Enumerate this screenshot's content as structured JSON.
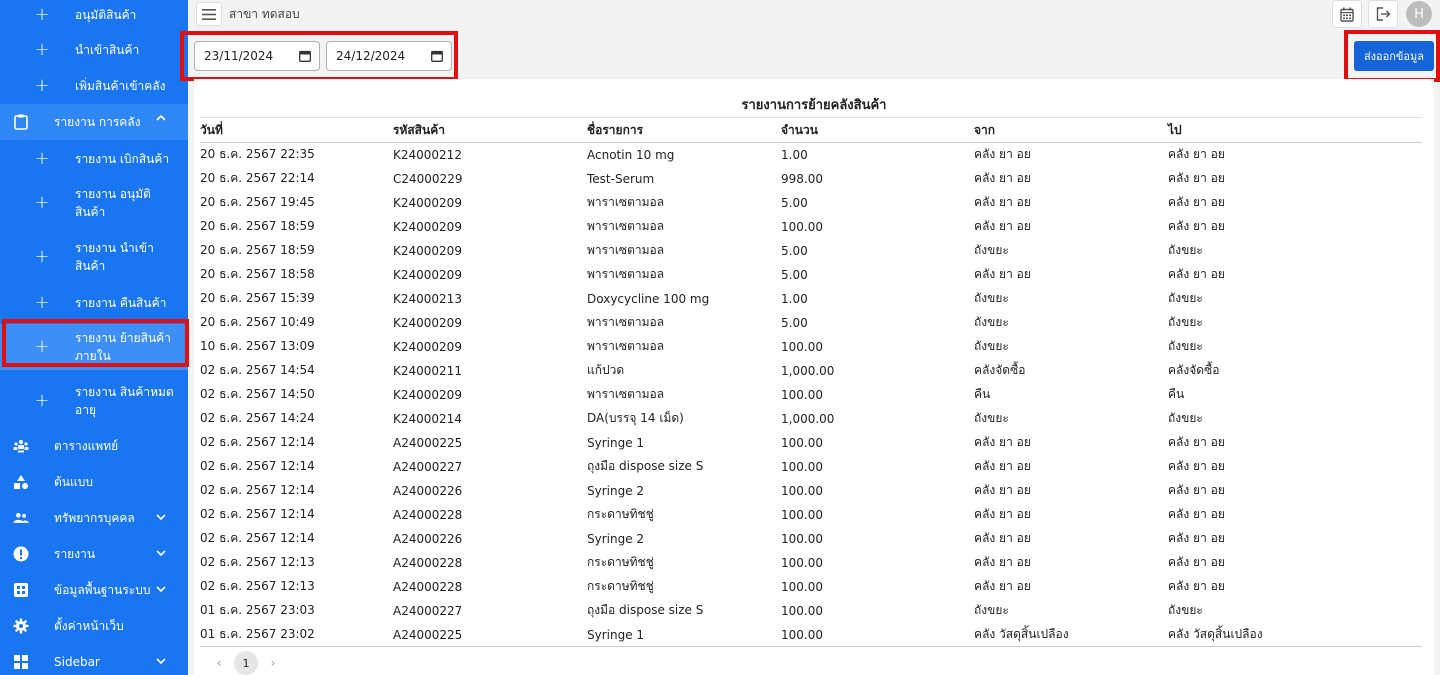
{
  "sidebar": {
    "items": [
      {
        "label": "อนุมัติสินค้า",
        "type": "sub"
      },
      {
        "label": "นำเข้าสินค้า",
        "type": "sub"
      },
      {
        "label": "เพิ่มสินค้าเข้าคลัง",
        "type": "sub"
      },
      {
        "label": "รายงาน การคลัง",
        "type": "main",
        "icon": "clipboard-icon",
        "chevron": "up"
      },
      {
        "label": "รายงาน เบิกสินค้า",
        "type": "sub"
      },
      {
        "label": "รายงาน อนุมัติสินค้า",
        "type": "sub"
      },
      {
        "label": "รายงาน นำเข้าสินค้า",
        "type": "sub"
      },
      {
        "label": "รายงาน คืนสินค้า",
        "type": "sub"
      },
      {
        "label": "รายงาน ย้ายสินค้าภายใน",
        "type": "sub",
        "selected": true
      },
      {
        "label": "รายงาน สินค้าหมดอายุ",
        "type": "sub"
      },
      {
        "label": "ตารางแพทย์",
        "type": "main",
        "icon": "people-network-icon"
      },
      {
        "label": "ต้นแบบ",
        "type": "main",
        "icon": "shapes-icon"
      },
      {
        "label": "ทรัพยากรบุคคล",
        "type": "main",
        "icon": "group-icon",
        "chevron": "down"
      },
      {
        "label": "รายงาน",
        "type": "main",
        "icon": "info-icon",
        "chevron": "down"
      },
      {
        "label": "ข้อมูลพื้นฐานระบบ",
        "type": "main",
        "icon": "grid-icon",
        "chevron": "down"
      },
      {
        "label": "ตั้งค่าหน้าเว็บ",
        "type": "main",
        "icon": "gear-icon"
      },
      {
        "label": "Sidebar",
        "type": "main",
        "icon": "dashboard-icon",
        "chevron": "down"
      }
    ]
  },
  "header": {
    "branch": "สาขา ทดสอบ",
    "avatar_initial": "H"
  },
  "filters": {
    "date_from": "23/11/2024",
    "date_to": "24/12/2024"
  },
  "export_label": "ส่งออกข้อมูล",
  "report": {
    "title": "รายงานการย้ายคลังสินค้า",
    "columns": [
      "วันที่",
      "รหัสสินค้า",
      "ชื่อรายการ",
      "จำนวน",
      "จาก",
      "ไป"
    ],
    "rows": [
      [
        "20 ธ.ค. 2567 22:35",
        "K24000212",
        "Acnotin 10 mg",
        "1.00",
        "คลัง ยา อย",
        "คลัง ยา อย"
      ],
      [
        "20 ธ.ค. 2567 22:14",
        "C24000229",
        "Test-Serum",
        "998.00",
        "คลัง ยา อย",
        "คลัง ยา อย"
      ],
      [
        "20 ธ.ค. 2567 19:45",
        "K24000209",
        "พาราเซตามอล",
        "5.00",
        "คลัง ยา อย",
        "คลัง ยา อย"
      ],
      [
        "20 ธ.ค. 2567 18:59",
        "K24000209",
        "พาราเซตามอล",
        "100.00",
        "คลัง ยา อย",
        "คลัง ยา อย"
      ],
      [
        "20 ธ.ค. 2567 18:59",
        "K24000209",
        "พาราเซตามอล",
        "5.00",
        "ถังขยะ",
        "ถังขยะ"
      ],
      [
        "20 ธ.ค. 2567 18:58",
        "K24000209",
        "พาราเซตามอล",
        "5.00",
        "คลัง ยา อย",
        "คลัง ยา อย"
      ],
      [
        "20 ธ.ค. 2567 15:39",
        "K24000213",
        "Doxycycline 100 mg",
        "1.00",
        "ถังขยะ",
        "ถังขยะ"
      ],
      [
        "20 ธ.ค. 2567 10:49",
        "K24000209",
        "พาราเซตามอล",
        "5.00",
        "ถังขยะ",
        "ถังขยะ"
      ],
      [
        "10 ธ.ค. 2567 13:09",
        "K24000209",
        "พาราเซตามอล",
        "100.00",
        "ถังขยะ",
        "ถังขยะ"
      ],
      [
        "02 ธ.ค. 2567 14:54",
        "K24000211",
        "แก้ปวด",
        "1,000.00",
        "คลังจัดซื้อ",
        "คลังจัดซื้อ"
      ],
      [
        "02 ธ.ค. 2567 14:50",
        "K24000209",
        "พาราเซตามอล",
        "100.00",
        "คืน",
        "คืน"
      ],
      [
        "02 ธ.ค. 2567 14:24",
        "K24000214",
        "DA(บรรจุ 14 เม็ด)",
        "1,000.00",
        "ถังขยะ",
        "ถังขยะ"
      ],
      [
        "02 ธ.ค. 2567 12:14",
        "A24000225",
        "Syringe 1",
        "100.00",
        "คลัง ยา อย",
        "คลัง ยา อย"
      ],
      [
        "02 ธ.ค. 2567 12:14",
        "A24000227",
        "ถุงมือ dispose size S",
        "100.00",
        "คลัง ยา อย",
        "คลัง ยา อย"
      ],
      [
        "02 ธ.ค. 2567 12:14",
        "A24000226",
        "Syringe 2",
        "100.00",
        "คลัง ยา อย",
        "คลัง ยา อย"
      ],
      [
        "02 ธ.ค. 2567 12:14",
        "A24000228",
        "กระดาษทิชชู่",
        "100.00",
        "คลัง ยา อย",
        "คลัง ยา อย"
      ],
      [
        "02 ธ.ค. 2567 12:14",
        "A24000226",
        "Syringe 2",
        "100.00",
        "คลัง ยา อย",
        "คลัง ยา อย"
      ],
      [
        "02 ธ.ค. 2567 12:13",
        "A24000228",
        "กระดาษทิชชู่",
        "100.00",
        "คลัง ยา อย",
        "คลัง ยา อย"
      ],
      [
        "02 ธ.ค. 2567 12:13",
        "A24000228",
        "กระดาษทิชชู่",
        "100.00",
        "คลัง ยา อย",
        "คลัง ยา อย"
      ],
      [
        "01 ธ.ค. 2567 23:03",
        "A24000227",
        "ถุงมือ dispose size S",
        "100.00",
        "ถังขยะ",
        "ถังขยะ"
      ],
      [
        "01 ธ.ค. 2567 23:02",
        "A24000225",
        "Syringe 1",
        "100.00",
        "คลัง วัสดุสิ้นเปลือง",
        "คลัง วัสดุสิ้นเปลือง"
      ]
    ]
  },
  "pagination": {
    "current": "1"
  },
  "colors": {
    "sidebar": "#1976f0",
    "primary_button": "#1565d8",
    "highlight": "#e01010"
  }
}
